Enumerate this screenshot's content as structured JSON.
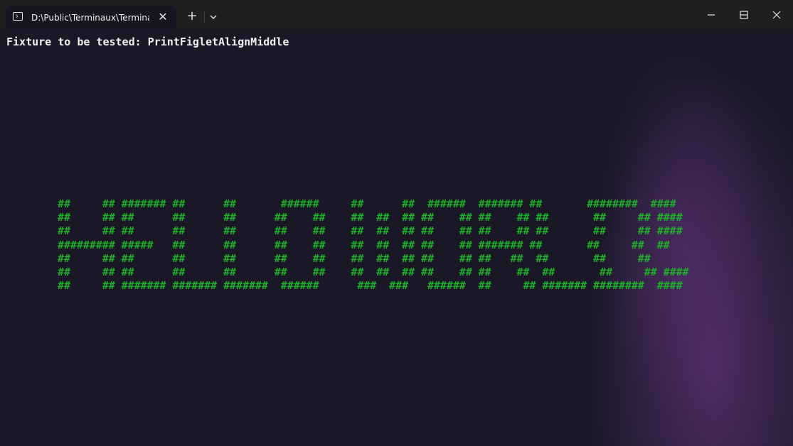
{
  "window": {
    "tab_title": "D:\\Public\\Terminaux\\Terminaux",
    "new_tab_symbol": "+",
    "close_tab_symbol": "✕"
  },
  "terminal": {
    "prompt_text": "Fixture to be tested: PrintFigletAlignMiddle",
    "figlet_color": "#1fae2a",
    "figlet_lines": [
      "##     ## ####### ##      ##       ######     ##      ##  ######  ####### ##       ########  ####",
      "##     ## ##      ##      ##      ##    ##    ##  ##  ## ##    ## ##    ## ##       ##     ## ####",
      "##     ## ##      ##      ##      ##    ##    ##  ##  ## ##    ## ##    ## ##       ##     ## ####",
      "######### #####   ##      ##      ##    ##    ##  ##  ## ##    ## ####### ##       ##     ##  ##",
      "##     ## ##      ##      ##      ##    ##    ##  ##  ## ##    ## ##   ##  ##       ##     ##",
      "##     ## ##      ##      ##      ##    ##    ##  ##  ## ##    ## ##    ##  ##       ##     ## ####",
      "##     ## ####### ####### #######  ######      ###  ###   ######  ##     ## ####### ########  ####"
    ]
  }
}
